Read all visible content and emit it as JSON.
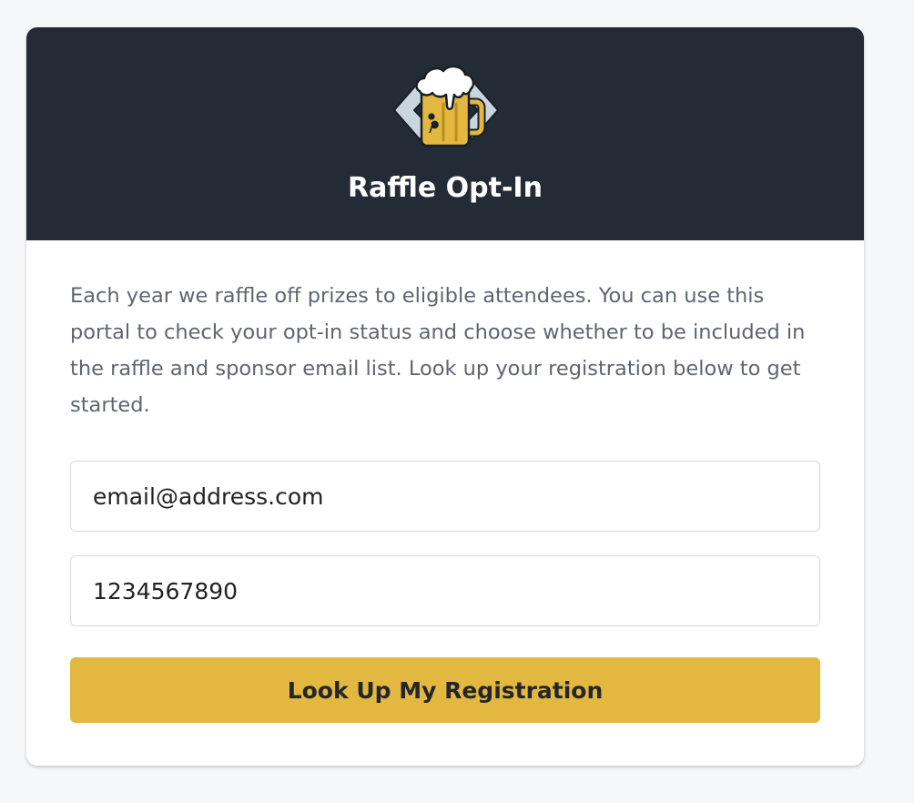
{
  "colors": {
    "page_background": "#f6f7f9",
    "header_background": "#232b36",
    "accent": "#e3b840",
    "intro_text": "#5f6570"
  },
  "header": {
    "logo_icon": "beer-mug-code-brackets-icon",
    "title": "Raffle Opt-In"
  },
  "main": {
    "intro": "Each year we raffle off prizes to eligible attendees. You can use this portal to check your opt-in status and choose whether to be included in the raffle and sponsor email list. Look up your registration below to get started.",
    "email_input": {
      "value": "email@address.com"
    },
    "registration_input": {
      "value": "1234567890"
    },
    "lookup_button_label": "Look Up My Registration"
  }
}
